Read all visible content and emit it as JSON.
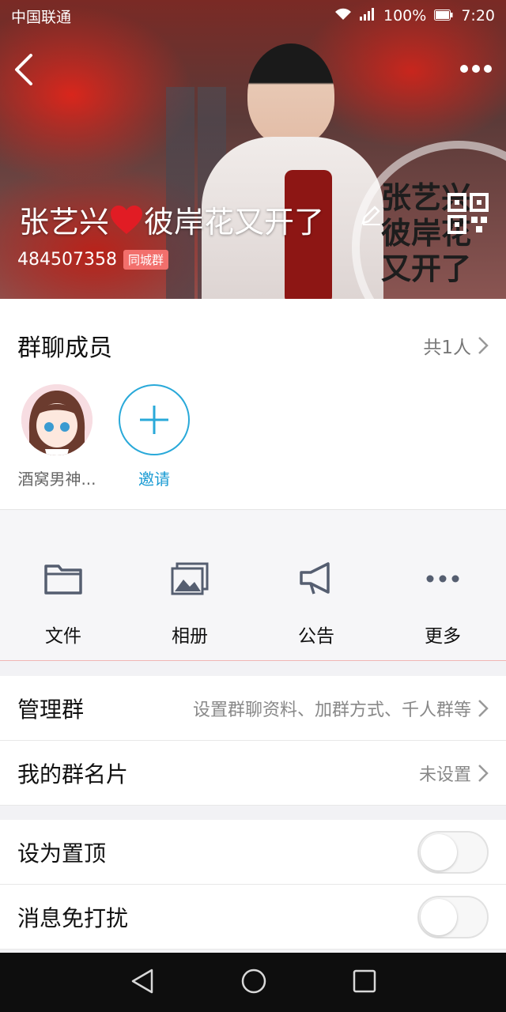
{
  "status_bar": {
    "carrier": "中国联通",
    "battery": "100%",
    "time": "7:20"
  },
  "header": {
    "group_title_part1": "张艺兴",
    "group_title_part2": "彼岸花又开了",
    "group_id": "484507358",
    "city_badge": "同城群",
    "stamp_lines": [
      "张艺兴",
      "彼岸花",
      "又开了"
    ]
  },
  "members": {
    "title": "群聊成员",
    "count": "共1人",
    "list": [
      {
        "label": "酒窝男神..."
      }
    ],
    "invite_label": "邀请"
  },
  "tools": [
    {
      "label": "文件",
      "icon": "folder-icon"
    },
    {
      "label": "相册",
      "icon": "album-icon"
    },
    {
      "label": "公告",
      "icon": "megaphone-icon"
    },
    {
      "label": "更多",
      "icon": "more-dots-icon"
    }
  ],
  "rows": {
    "manage": {
      "label": "管理群",
      "value": "设置群聊资料、加群方式、千人群等"
    },
    "card": {
      "label": "我的群名片",
      "value": "未设置"
    },
    "pin": {
      "label": "设为置顶",
      "on": false
    },
    "mute": {
      "label": "消息免打扰",
      "on": false
    }
  },
  "colors": {
    "accent_blue": "#29a9d9",
    "badge_red": "#f26f6c"
  }
}
